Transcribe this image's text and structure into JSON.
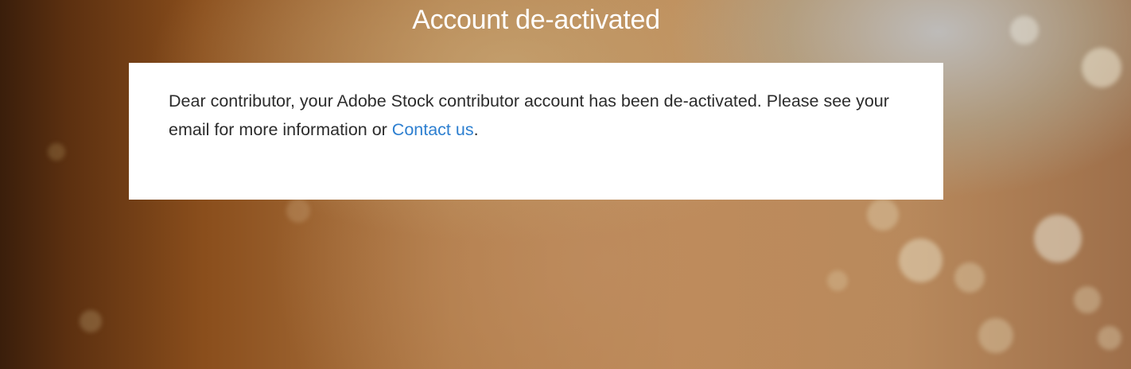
{
  "page": {
    "title": "Account de-activated"
  },
  "notice": {
    "message_text": "Dear contributor, your Adobe Stock contributor account has been de-activated. Please see your email for more information or ",
    "contact_link_label": "Contact us",
    "trailing_punctuation": "."
  },
  "colors": {
    "link": "#2d7fd0",
    "card_background": "#ffffff",
    "title_text": "#ffffff"
  }
}
